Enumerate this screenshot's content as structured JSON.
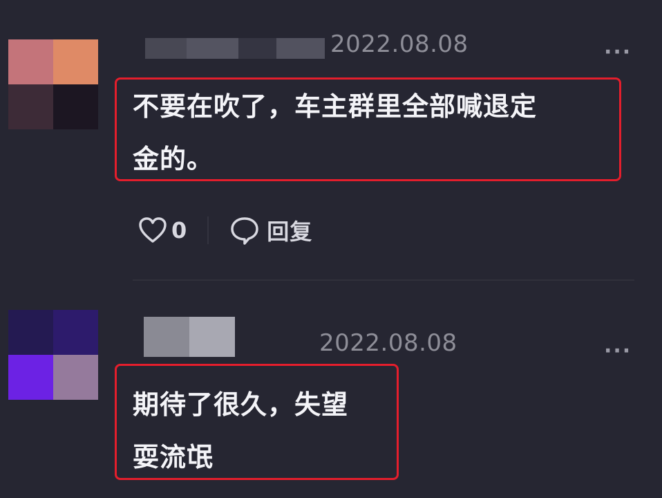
{
  "comments": [
    {
      "avatar_colors": [
        "#c4747a",
        "#df8a66",
        "#3d2b37",
        "#1c1622"
      ],
      "username_colors": [
        "#4c4c58",
        "#5a5a66",
        "#3a3a46",
        "#585864"
      ],
      "timestamp": "2022.08.08",
      "text_lines": [
        "不要在吹了，车主群里全部喊退定",
        "金的。"
      ],
      "like_count": "0",
      "reply_label": "回复",
      "more_label": "···"
    },
    {
      "avatar_colors": [
        "#241a52",
        "#2d1b6c",
        "#6c22e4",
        "#957a9c"
      ],
      "username_colors": [
        "#8a8a94",
        "#a8a8b2"
      ],
      "timestamp": "2022.08.08",
      "text_lines": [
        "期待了很久，失望",
        "耍流氓"
      ],
      "more_label": "···"
    }
  ]
}
